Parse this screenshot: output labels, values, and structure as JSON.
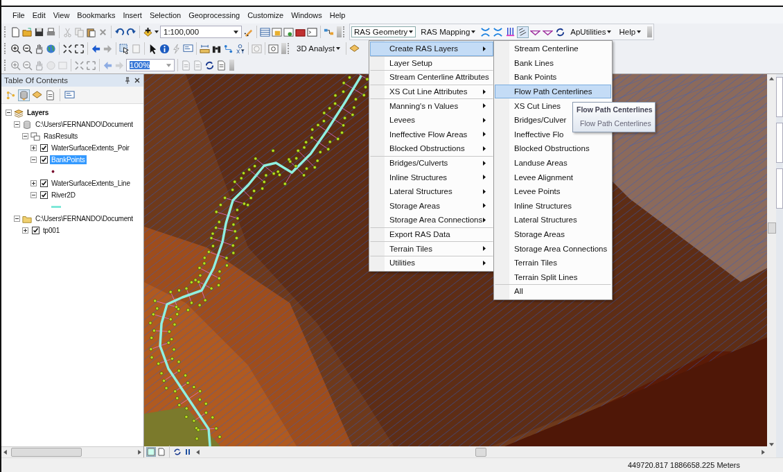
{
  "menu_bar": [
    "File",
    "Edit",
    "View",
    "Bookmarks",
    "Insert",
    "Selection",
    "Geoprocessing",
    "Customize",
    "Windows",
    "Help"
  ],
  "toolbar_1": {
    "scale": "1:100,000",
    "ras_menus": [
      {
        "label": "RAS Geometry",
        "selected": true
      },
      {
        "label": "RAS Mapping",
        "selected": false
      }
    ],
    "ap_utilities": "ApUtilities",
    "help": "Help"
  },
  "toolbar_2": {
    "analyst": "3D Analyst"
  },
  "toolbar_3": {
    "zoom_percent": "100%"
  },
  "toc": {
    "title": "Table Of Contents",
    "tree": [
      {
        "label": "Layers",
        "kind": "frame",
        "expanded": true,
        "children": [
          {
            "label": "C:\\Users\\FERNANDO\\Document",
            "kind": "database",
            "expanded": true,
            "children": [
              {
                "label": "RasResults",
                "kind": "group",
                "expanded": true,
                "children": [
                  {
                    "label": "WaterSurfaceExtents_Poir",
                    "kind": "layer",
                    "expanded": false,
                    "checked": true,
                    "selected": false
                  },
                  {
                    "label": "BankPoints",
                    "kind": "layer",
                    "expanded": true,
                    "checked": true,
                    "selected": true,
                    "point_symbol": true
                  },
                  {
                    "label": "WaterSurfaceExtents_Line",
                    "kind": "layer",
                    "expanded": false,
                    "checked": true,
                    "selected": false
                  },
                  {
                    "label": "River2D",
                    "kind": "layer",
                    "expanded": true,
                    "checked": true,
                    "selected": false,
                    "line_symbol": true
                  }
                ]
              }
            ]
          },
          {
            "label": "C:\\Users\\FERNANDO\\Document",
            "kind": "folder",
            "expanded": true,
            "children": [
              {
                "label": "tp001",
                "kind": "layer",
                "expanded": false,
                "checked": true,
                "selected": false
              }
            ]
          }
        ]
      }
    ]
  },
  "ras_geometry_menu": [
    {
      "label": "Create RAS Layers",
      "submenu": true,
      "selected": true,
      "separator_before": false
    },
    {
      "label": "Layer Setup",
      "submenu": false,
      "selected": false,
      "separator_before": true
    },
    {
      "label": "Stream Centerline Attributes",
      "submenu": true,
      "selected": false,
      "separator_before": true
    },
    {
      "label": "XS Cut Line Attributes",
      "submenu": true,
      "selected": false,
      "separator_before": true
    },
    {
      "label": "Manning's n Values",
      "submenu": true,
      "selected": false,
      "separator_before": true
    },
    {
      "label": "Levees",
      "submenu": true,
      "selected": false,
      "separator_before": false
    },
    {
      "label": "Ineffective Flow Areas",
      "submenu": true,
      "selected": false,
      "separator_before": false
    },
    {
      "label": "Blocked Obstructions",
      "submenu": true,
      "selected": false,
      "separator_before": false
    },
    {
      "label": "Bridges/Culverts",
      "submenu": true,
      "selected": false,
      "separator_before": true
    },
    {
      "label": "Inline Structures",
      "submenu": true,
      "selected": false,
      "separator_before": false
    },
    {
      "label": "Lateral Structures",
      "submenu": true,
      "selected": false,
      "separator_before": false
    },
    {
      "label": "Storage Areas",
      "submenu": true,
      "selected": false,
      "separator_before": false
    },
    {
      "label": "Storage Area Connections",
      "submenu": true,
      "selected": false,
      "separator_before": false
    },
    {
      "label": "Export RAS Data",
      "submenu": false,
      "selected": false,
      "separator_before": true
    },
    {
      "label": "Terrain Tiles",
      "submenu": true,
      "selected": false,
      "separator_before": true
    },
    {
      "label": "Utilities",
      "submenu": true,
      "selected": false,
      "separator_before": true
    }
  ],
  "create_layers_submenu": [
    {
      "label": "Stream Centerline",
      "selected": false,
      "separator_before": false
    },
    {
      "label": "Bank Lines",
      "selected": false,
      "separator_before": false
    },
    {
      "label": "Bank Points",
      "selected": false,
      "separator_before": false
    },
    {
      "label": "Flow Path Centerlines",
      "selected": true,
      "separator_before": false
    },
    {
      "label": "XS Cut Lines",
      "selected": false,
      "separator_before": false
    },
    {
      "label": "Bridges/Culver",
      "selected": false,
      "separator_before": false
    },
    {
      "label": "Ineffective Flo",
      "selected": false,
      "separator_before": false
    },
    {
      "label": "Blocked Obstructions",
      "selected": false,
      "separator_before": false
    },
    {
      "label": "Landuse Areas",
      "selected": false,
      "separator_before": false
    },
    {
      "label": "Levee Alignment",
      "selected": false,
      "separator_before": false
    },
    {
      "label": "Levee Points",
      "selected": false,
      "separator_before": false
    },
    {
      "label": "Inline Structures",
      "selected": false,
      "separator_before": false
    },
    {
      "label": "Lateral Structures",
      "selected": false,
      "separator_before": false
    },
    {
      "label": "Storage Areas",
      "selected": false,
      "separator_before": false
    },
    {
      "label": "Storage Area Connections",
      "selected": false,
      "separator_before": false
    },
    {
      "label": "Terrain Tiles",
      "selected": false,
      "separator_before": false
    },
    {
      "label": "Terrain Split Lines",
      "selected": false,
      "separator_before": false
    },
    {
      "label": "All",
      "selected": false,
      "separator_before": true
    }
  ],
  "tooltip": {
    "title": "Flow Path Centerlines",
    "text": "Flow Path Centerlines"
  },
  "status_bar": {
    "coordinates": "449720.817  1886658.225 Meters"
  }
}
